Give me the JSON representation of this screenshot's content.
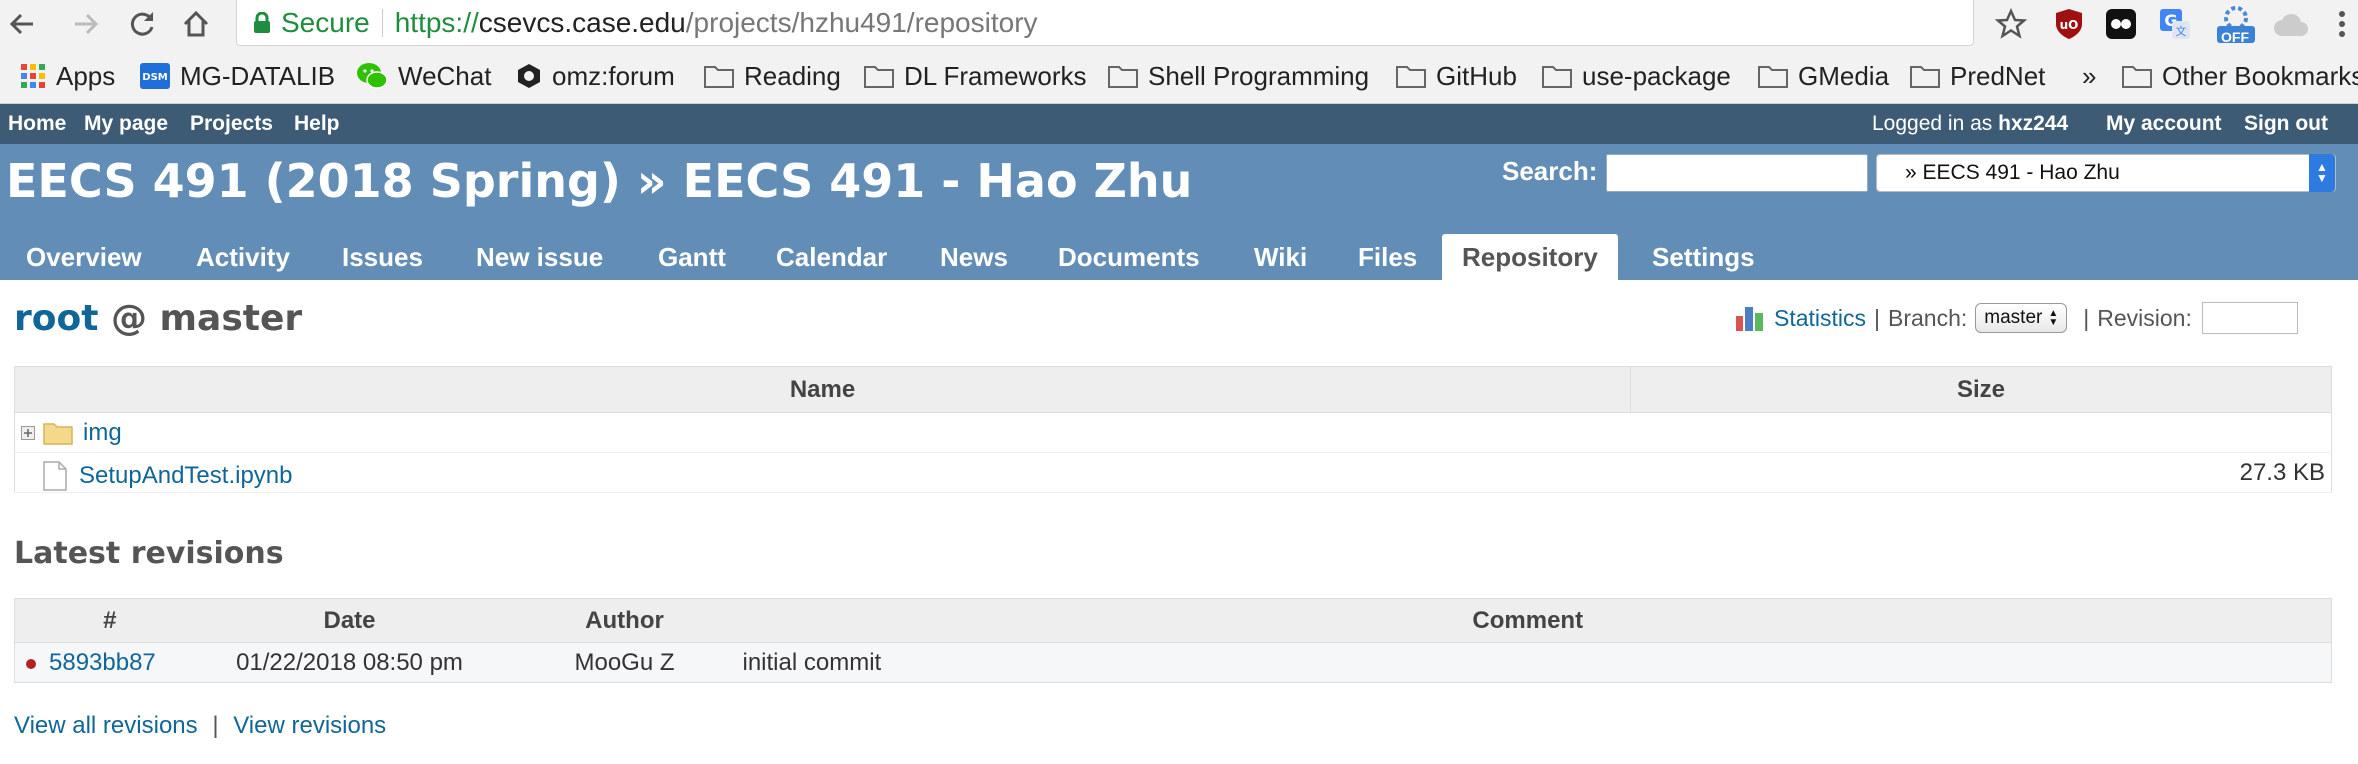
{
  "browser": {
    "secure_label": "Secure",
    "url_scheme": "https://",
    "url_host": "csevcs.case.edu",
    "url_path": "/projects/hzhu491/repository",
    "ext_off_badge": "OFF"
  },
  "bookmarks": [
    {
      "label": "Apps",
      "icon": "apps-grid-icon"
    },
    {
      "label": "MG-DATALIB",
      "icon": "dsm-icon"
    },
    {
      "label": "WeChat",
      "icon": "wechat-icon"
    },
    {
      "label": "omz:forum",
      "icon": "hexagon-icon"
    },
    {
      "label": "Reading",
      "icon": "folder-icon"
    },
    {
      "label": "DL Frameworks",
      "icon": "folder-icon"
    },
    {
      "label": "Shell Programming",
      "icon": "folder-icon"
    },
    {
      "label": "GitHub",
      "icon": "folder-icon"
    },
    {
      "label": "use-package",
      "icon": "folder-icon"
    },
    {
      "label": "GMedia",
      "icon": "folder-icon"
    },
    {
      "label": "PredNet",
      "icon": "folder-icon"
    },
    {
      "label": "»",
      "icon": ""
    },
    {
      "label": "Other Bookmarks",
      "icon": "folder-icon"
    }
  ],
  "top_menu": {
    "home": "Home",
    "my_page": "My page",
    "projects": "Projects",
    "help": "Help",
    "logged_in_as": "Logged in as",
    "username": "hxz244",
    "my_account": "My account",
    "sign_out": "Sign out"
  },
  "header": {
    "title": "EECS 491 (2018 Spring) » EECS 491 - Hao Zhu",
    "search_label": "Search:",
    "jump_value": "» EECS 491 - Hao Zhu"
  },
  "tabs": [
    "Overview",
    "Activity",
    "Issues",
    "New issue",
    "Gantt",
    "Calendar",
    "News",
    "Documents",
    "Wiki",
    "Files",
    "Repository",
    "Settings"
  ],
  "selected_tab": "Repository",
  "repository": {
    "root_label": "root",
    "at_branch": "@ master",
    "statistics": "Statistics",
    "separator": "|",
    "branch_label": "Branch:",
    "branch_value": "master",
    "revision_label": "Revision:",
    "columns": {
      "name": "Name",
      "size": "Size"
    },
    "entries": [
      {
        "name": "img",
        "type": "folder",
        "size": ""
      },
      {
        "name": "SetupAndTest.ipynb",
        "type": "file",
        "size": "27.3 KB"
      }
    ]
  },
  "latest_revisions": {
    "title": "Latest revisions",
    "columns": {
      "number": "#",
      "date": "Date",
      "author": "Author",
      "comment": "Comment"
    },
    "rows": [
      {
        "revision": "5893bb87",
        "date": "01/22/2018 08:50 pm",
        "author": "MooGu Z",
        "comment": "initial commit"
      }
    ],
    "view_all": "View all revisions",
    "separator": "|",
    "view_revisions": "View revisions"
  },
  "colors": {
    "top_menu_bg": "#3e5b76",
    "header_bg": "#628db6",
    "link": "#169",
    "secure_green": "#1e8e3e"
  }
}
